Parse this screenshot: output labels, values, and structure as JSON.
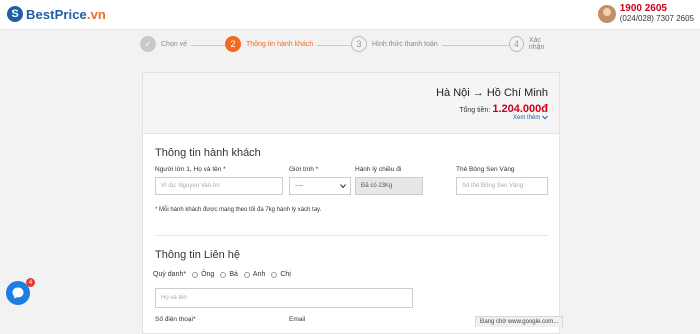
{
  "header": {
    "logo_text_a": "BestPrice",
    "logo_text_b": ".vn",
    "logo_mark": "S",
    "hotline_main": "1900 2605",
    "hotline_sub": "(024/028) 7307 2605"
  },
  "steps": [
    {
      "num": "✓",
      "label": "Chọn vé",
      "state": "done"
    },
    {
      "num": "2",
      "label": "Thông tin hành khách",
      "state": "active"
    },
    {
      "num": "3",
      "label": "Hình thức thanh toán",
      "state": "todo"
    },
    {
      "num": "4",
      "label": "Xác nhận",
      "state": "todo"
    }
  ],
  "summary": {
    "route_from": "Hà Nội",
    "route_arrow": "→",
    "route_to": "Hồ Chí Minh",
    "total_label": "Tổng tiền:",
    "total_value": "1.204.000đ",
    "more_label": "Xem thêm"
  },
  "passenger": {
    "title": "Thông tin hành khách",
    "name_label": "Người lớn 1, Họ và tên *",
    "name_placeholder": "Ví dụ: Nguyen Van An",
    "gender_label": "Giới tính *",
    "gender_value": "----",
    "baggage_label": "Hành lý chiều đi",
    "baggage_value": "Đã có 23Kg",
    "card_label": "Thẻ Bông Sen Vàng",
    "card_placeholder": "Số thẻ Bông Sen Vàng",
    "note": "* Mỗi hành khách được mang theo tối đa 7kg hành lý xách tay."
  },
  "contact": {
    "title": "Thông tin Liên hệ",
    "salutation_label": "Quý danh*",
    "salutations": [
      "Ông",
      "Bà",
      "Anh",
      "Chị"
    ],
    "fullname_placeholder": "Họ và tên",
    "phone_label": "Số điện thoại*",
    "email_label": "Email"
  },
  "chat": {
    "badge": "4"
  },
  "status_bar": "Đang chờ www.google.com..."
}
